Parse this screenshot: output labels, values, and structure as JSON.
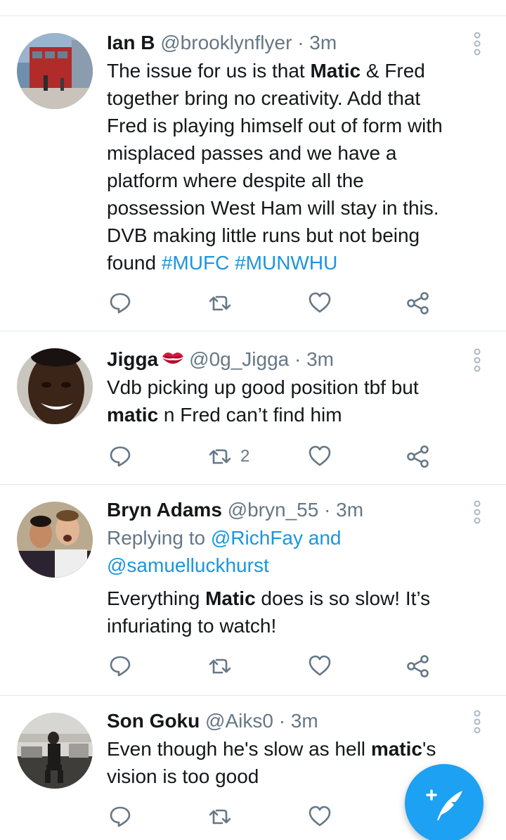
{
  "tweets": [
    {
      "name": "Ian B",
      "handle": "@brooklynflyer",
      "time": "· 3m",
      "body_lines": [
        [
          {
            "t": "The issue for us is that "
          },
          {
            "t": "Matic",
            "b": true
          },
          {
            "t": " & Fred"
          }
        ],
        [
          {
            "t": "together bring no creativity. Add that"
          }
        ],
        [
          {
            "t": "Fred is playing himself out of form with"
          }
        ],
        [
          {
            "t": "misplaced passes and we have a"
          }
        ],
        [
          {
            "t": "platform where despite all the"
          }
        ],
        [
          {
            "t": "possession West Ham will stay in this."
          }
        ],
        [
          {
            "t": "DVB making little runs but not being"
          }
        ],
        [
          {
            "t": "found "
          },
          {
            "t": "#MUFC #MUNWHU",
            "link": true
          }
        ]
      ],
      "retweets": "",
      "avatar_icon": "stadium-photo"
    },
    {
      "name": "Jigga",
      "handle": "@0g_Jigga",
      "time": "· 3m",
      "emoji": "kiss-mark",
      "body_lines": [
        [
          {
            "t": "Vdb picking up good position tbf but"
          }
        ],
        [
          {
            "t": "matic",
            "b": true
          },
          {
            "t": " n Fred can’t find him"
          }
        ]
      ],
      "retweets": "2",
      "avatar_icon": "smiling-face-photo"
    },
    {
      "name": "Bryn Adams",
      "handle": "@bryn_55",
      "time": "· 3m",
      "reply_prefix": "Replying to ",
      "reply_to_1": "@RichFay and",
      "reply_to_2": "@samuelluckhurst",
      "body_lines": [
        [
          {
            "t": "Everything "
          },
          {
            "t": "Matic",
            "b": true
          },
          {
            "t": " does is so slow! It’s"
          }
        ],
        [
          {
            "t": "infuriating to watch!"
          }
        ]
      ],
      "retweets": "",
      "avatar_icon": "two-men-photo"
    },
    {
      "name": "Son Goku",
      "handle": "@Aiks0",
      "time": "· 3m",
      "body_lines": [
        [
          {
            "t": "Even though he's slow as hell "
          },
          {
            "t": "matic",
            "b": true
          },
          {
            "t": "'s"
          }
        ],
        [
          {
            "t": "vision is too good"
          }
        ]
      ],
      "retweets": "",
      "avatar_icon": "kitchen-photo"
    }
  ],
  "colors": {
    "accent": "#1da1f2",
    "link": "#1b95e0",
    "muted": "#657786",
    "divider": "#e1e8ed",
    "emoji": "#d4163c"
  },
  "icons": [
    "reply-icon",
    "retweet-icon",
    "like-icon",
    "share-icon",
    "more-options-icon",
    "compose-tweet-icon"
  ]
}
